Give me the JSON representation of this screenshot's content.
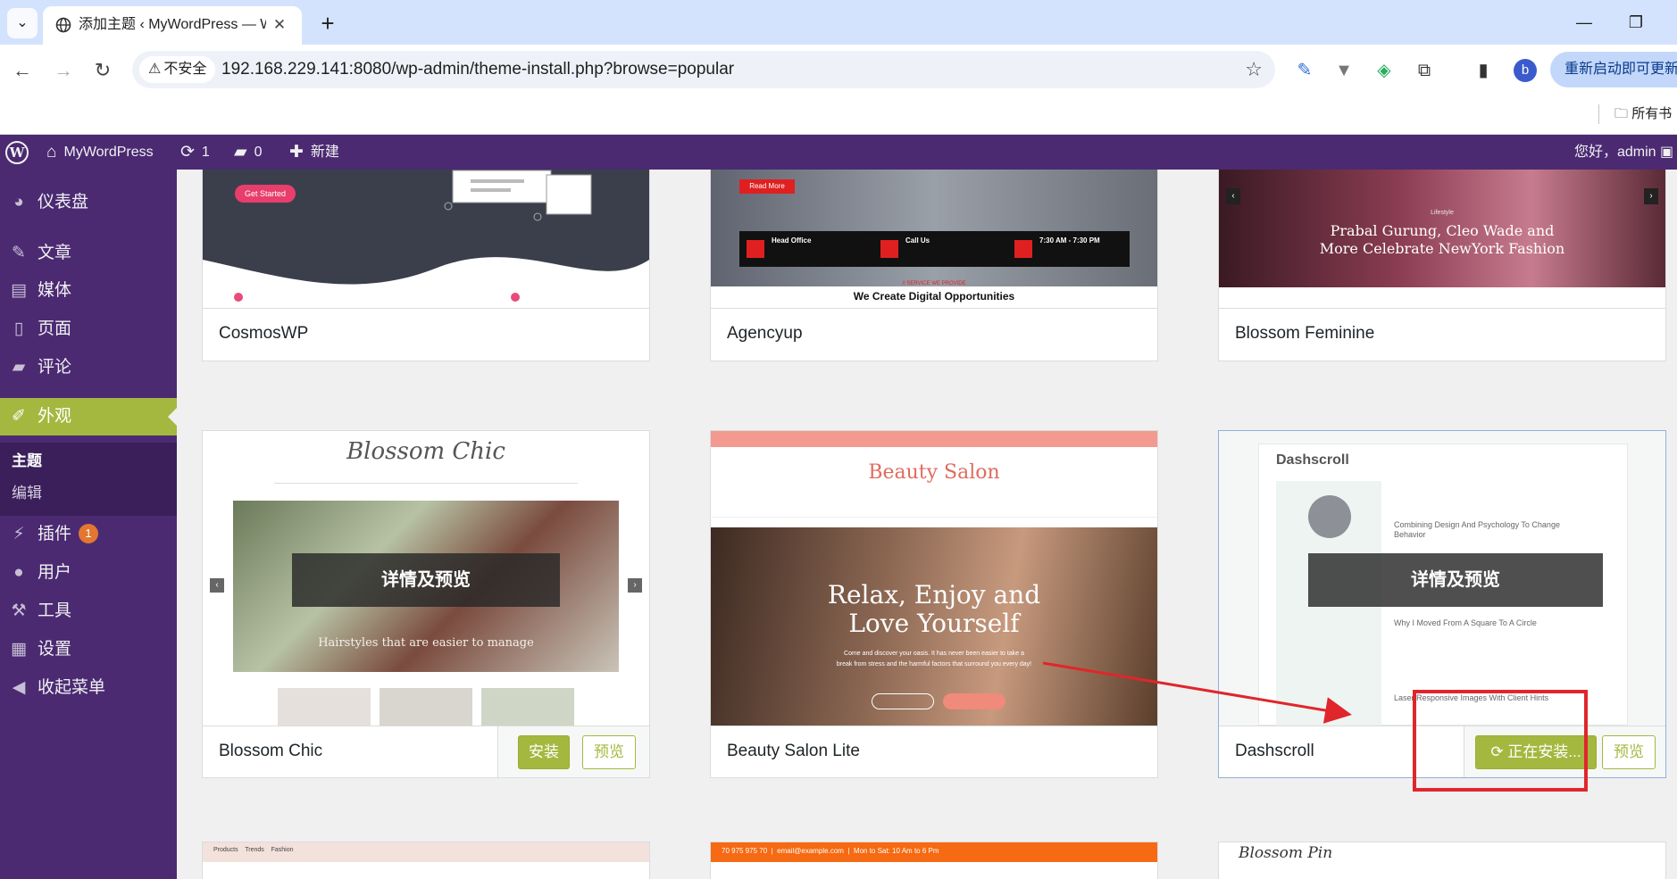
{
  "browser": {
    "tab_title": "添加主题 ‹ MyWordPress — W",
    "tab_close": "✕",
    "new_tab": "+",
    "insecure_label": "不安全",
    "url": "192.168.229.141:8080/wp-admin/theme-install.php?browse=popular",
    "profile_initial": "b",
    "relaunch_label": "重新启动即可更新",
    "bookmark_folder": "所有书"
  },
  "adminbar": {
    "site_name": "MyWordPress",
    "updates_count": "1",
    "comments_count": "0",
    "new_label": "新建",
    "greeting": "您好，admin"
  },
  "sidebar": {
    "items": [
      {
        "label": "仪表盘",
        "icon": "dashboard-icon"
      },
      {
        "label": "文章",
        "icon": "pin-icon"
      },
      {
        "label": "媒体",
        "icon": "media-icon"
      },
      {
        "label": "页面",
        "icon": "page-icon"
      },
      {
        "label": "评论",
        "icon": "comment-icon"
      },
      {
        "label": "外观",
        "icon": "brush-icon"
      },
      {
        "label": "插件",
        "icon": "plugin-icon",
        "badge": "1"
      },
      {
        "label": "用户",
        "icon": "user-icon"
      },
      {
        "label": "工具",
        "icon": "wrench-icon"
      },
      {
        "label": "设置",
        "icon": "settings-icon"
      },
      {
        "label": "收起菜单",
        "icon": "collapse-icon"
      }
    ],
    "submenu": [
      {
        "label": "主题"
      },
      {
        "label": "编辑"
      }
    ]
  },
  "themes": {
    "row1": [
      "CosmosWP",
      "Agencyup",
      "Blossom Feminine"
    ],
    "row2": [
      "Blossom Chic",
      "Beauty Salon Lite",
      "Dashscroll"
    ],
    "install_label": "安装",
    "preview_label": "预览",
    "installing_label": "正在安装...",
    "details_label": "详情及预览"
  },
  "screenshots": {
    "cosmos_cta": "Get Started",
    "agency_readmore": "Read More",
    "agency_office": "Head Office",
    "agency_call": "Call Us",
    "agency_hours": "7:30 AM - 7:30 PM",
    "agency_kicker": "// SERVICE WE PROVIDE",
    "agency_heading": "We Create Digital Opportunities",
    "feminine_kicker": "Lifestyle",
    "feminine_headline_1": "Prabal Gurung, Cleo Wade and",
    "feminine_headline_2": "More Celebrate NewYork Fashion",
    "chic_logo": "Blossom Chic",
    "chic_caption": "Hairstyles that are easier to manage",
    "salon_logo": "Beauty Salon",
    "salon_headline_1": "Relax, Enjoy and",
    "salon_headline_2": "Love Yourself",
    "salon_body": "Come and discover your oasis. It has never been easier to take a break from stress and the harmful factors that surround you every day!",
    "dash_logo": "Dashscroll",
    "dash_post_1": "Combining Design And Psychology To Change Behavior",
    "dash_post_2": "Why I Moved From A Square To A Circle",
    "dash_post_3": "Laser Responsive Images With Client Hints",
    "row3_left_nav": "Products    Trends    Fashion",
    "row3_mid_phone": "70 975 975 70  |  email@example.com  |  Mon to Sat: 10 Am to 6 Pm",
    "row3_right_logo": "Blossom Pin"
  },
  "colors": {
    "admin_purple": "#4b2a72",
    "accent_green": "#a4b83f",
    "annotation_red": "#e0262b"
  }
}
